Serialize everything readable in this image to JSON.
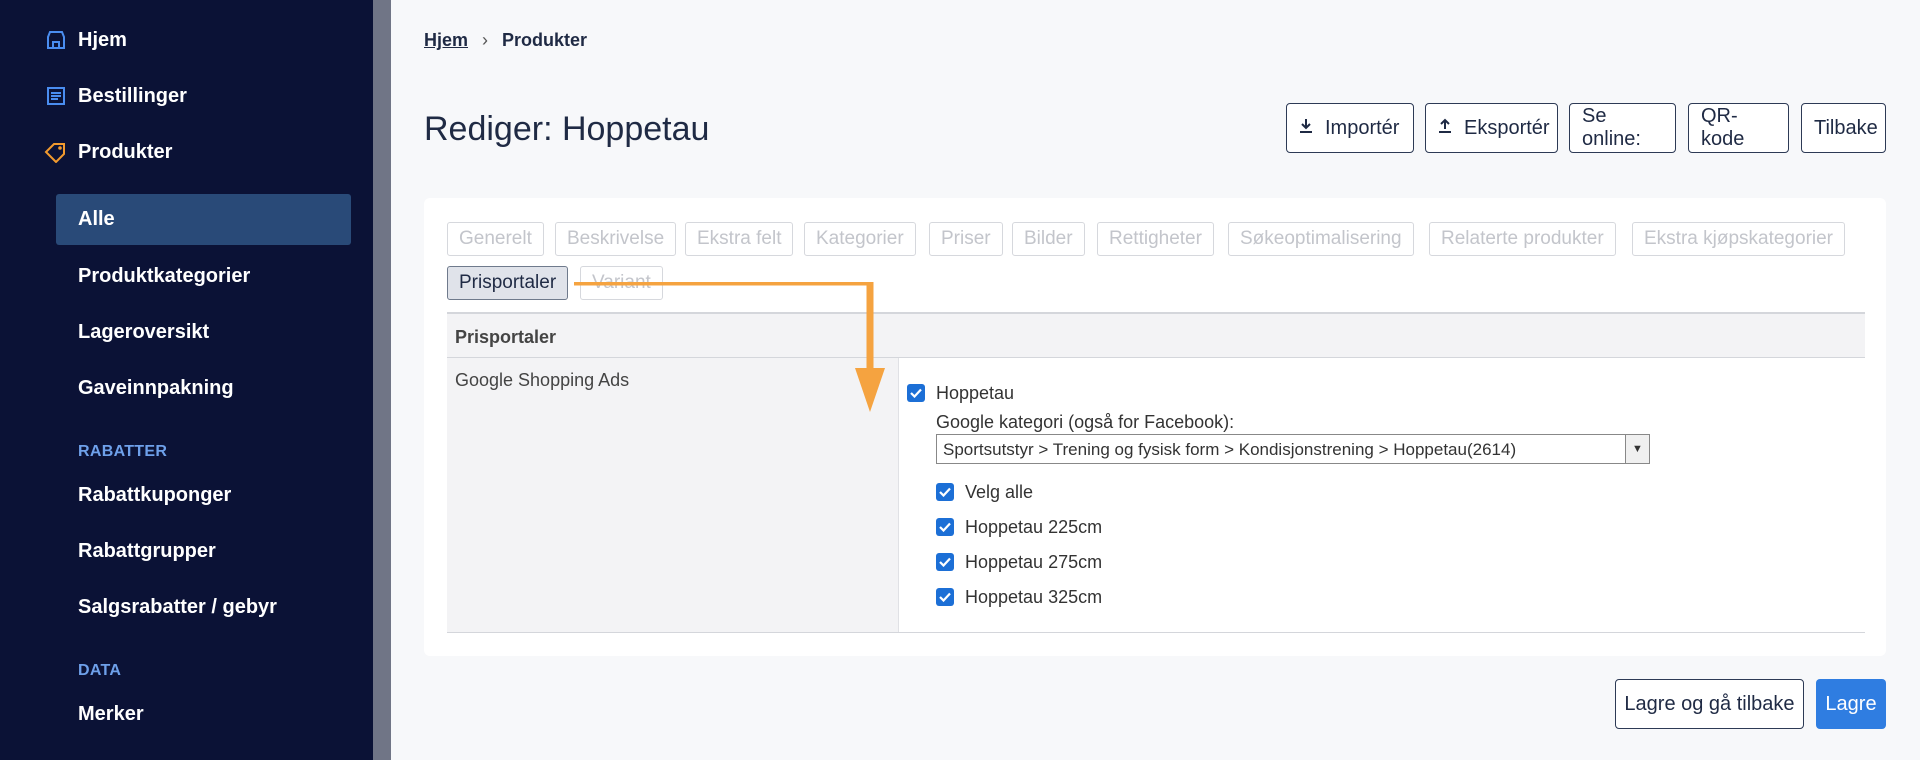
{
  "sidebar": {
    "home": "Hjem",
    "orders": "Bestillinger",
    "products": "Produkter",
    "items": [
      "Alle",
      "Produktkategorier",
      "Lageroversikt",
      "Gaveinnpakning"
    ],
    "discounts_heading": "RABATTER",
    "discount_items": [
      "Rabattkuponger",
      "Rabattgrupper",
      "Salgsrabatter / gebyr"
    ],
    "data_heading": "DATA",
    "data_items": [
      "Merker"
    ],
    "icon_colors": {
      "home": "#4a8df0",
      "orders": "#4a8df0",
      "products": "#f29a2e"
    }
  },
  "breadcrumb": {
    "home": "Hjem",
    "current": "Produkter"
  },
  "page": {
    "title": "Rediger: Hoppetau"
  },
  "actions": {
    "import": "Importér",
    "export": "Eksportér",
    "view_online": "Se online:",
    "qr": "QR-kode",
    "back": "Tilbake"
  },
  "tabs": [
    "Generelt",
    "Beskrivelse",
    "Ekstra felt",
    "Kategorier",
    "Priser",
    "Bilder",
    "Rettigheter",
    "Søkeoptimalisering",
    "Relaterte produkter",
    "Ekstra kjøpskategorier",
    "Prisportaler",
    "Variant"
  ],
  "active_tab": "Prisportaler",
  "section": {
    "header": "Prisportaler",
    "row_label": "Google Shopping Ads",
    "main_checkbox": "Hoppetau",
    "google_category_label": "Google kategori (også for Facebook):",
    "google_category_value": "Sportsutstyr > Trening og fysisk form > Kondisjonstrening > Hoppetau(2614)",
    "select_all": "Velg alle",
    "variants": [
      "Hoppetau 225cm",
      "Hoppetau 275cm",
      "Hoppetau 325cm"
    ]
  },
  "footer": {
    "save_back": "Lagre og gå tilbake",
    "save": "Lagre"
  },
  "colors": {
    "sidebar_bg": "#0b1236",
    "active_nav": "#294a78",
    "primary": "#2f7de1",
    "arrow": "#f5a340",
    "checkbox": "#1c6fd6"
  }
}
